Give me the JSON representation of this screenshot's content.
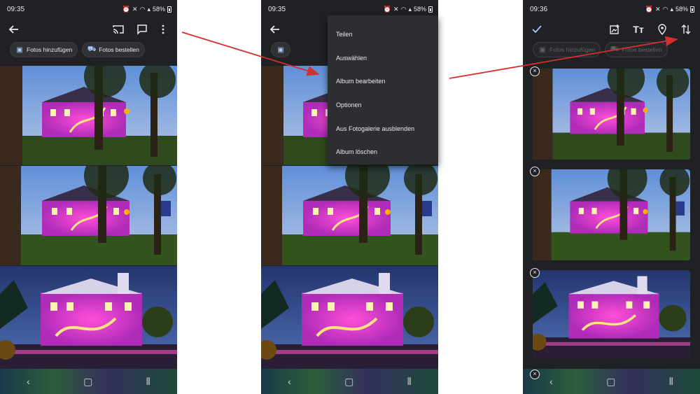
{
  "status": {
    "time_1": "09:35",
    "time_2": "09:35",
    "time_3": "09:36",
    "battery": "58%"
  },
  "album_view": {
    "chips": {
      "add_photos": "Fotos hinzufügen",
      "order_photos": "Fotos bestellen"
    }
  },
  "overflow_menu": {
    "items": [
      "Teilen",
      "Auswählen",
      "Album bearbeiten",
      "Optionen",
      "Aus Fotogalerie ausblenden",
      "Album löschen"
    ]
  },
  "edit_view": {
    "chips": {
      "add_photos": "Fotos hinzufügen",
      "order_photos": "Fotos bestellen"
    },
    "remove_symbol": "×"
  },
  "icons": {
    "back": "arrow-left-icon",
    "cast": "cast-icon",
    "comment": "comment-icon",
    "more": "more-vert-icon",
    "done": "check-icon",
    "add_photo": "add-photo-icon",
    "text": "text-format-icon",
    "location": "location-pin-icon",
    "sort": "sort-arrows-icon",
    "nav_back": "nav-back-icon",
    "nav_home": "nav-home-icon",
    "nav_recents": "nav-recents-icon"
  },
  "colors": {
    "app_bg": "#202124",
    "menu_bg": "#2d2e31",
    "chip_icon": "#a8c7fa",
    "annotation_arrow": "#d32f2f"
  }
}
